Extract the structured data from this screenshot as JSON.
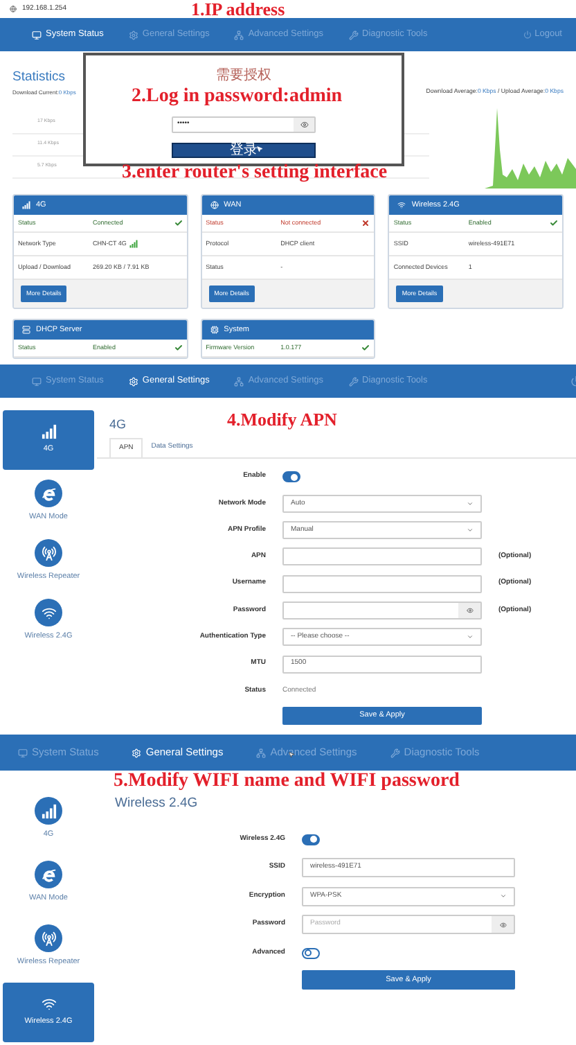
{
  "browser": {
    "address": "192.168.1.254"
  },
  "status_page": {
    "navbar": {
      "items": [
        {
          "label": "System Status",
          "selected": true
        },
        {
          "label": "General Settings",
          "selected": false
        },
        {
          "label": "Advanced Settings",
          "selected": false
        },
        {
          "label": "Diagnostic Tools",
          "selected": false
        }
      ],
      "logout": "Logout"
    },
    "statistics": {
      "title": "Statistics",
      "current": [
        {
          "label": "Download Current:",
          "value": "0 Kbps"
        }
      ],
      "averages": [
        {
          "label": "Download Average:",
          "value": "0 Kbps"
        },
        {
          "label": " / Upload Average:",
          "value": "0 Kbps"
        }
      ],
      "y_labels": [
        "17 Kbps",
        "11.4 Kbps",
        "5.7 Kbps"
      ]
    },
    "login_dialog": {
      "title": "需要授权",
      "password": "•••••",
      "button": "登录"
    },
    "cards": [
      {
        "title": "4G",
        "rows": [
          {
            "label": "Status",
            "value": "Connected",
            "kind": "check"
          },
          {
            "label": "Network Type",
            "value": "CHN-CT 4G",
            "kind": "signal"
          },
          {
            "label": "Upload / Download",
            "value": "269.20 KB / 7.91 KB",
            "kind": "plain"
          }
        ],
        "button": "More Details"
      },
      {
        "title": "WAN",
        "rows": [
          {
            "label": "Status",
            "value": "Not connected",
            "kind": "cross"
          },
          {
            "label": "Protocol",
            "value": "DHCP client",
            "kind": "plain"
          },
          {
            "label": "Status",
            "value": "-",
            "kind": "plain"
          }
        ],
        "button": "More Details"
      },
      {
        "title": "Wireless 2.4G",
        "rows": [
          {
            "label": "Status",
            "value": "Enabled",
            "kind": "check"
          },
          {
            "label": "SSID",
            "value": "wireless-491E71",
            "kind": "plain"
          },
          {
            "label": "Connected Devices",
            "value": "1",
            "kind": "plain"
          }
        ],
        "button": "More Details"
      },
      {
        "title": "DHCP Server",
        "rows": [
          {
            "label": "Status",
            "value": "Enabled",
            "kind": "check"
          }
        ]
      },
      {
        "title": "System",
        "rows": [
          {
            "label": "Firmware Version",
            "value": "1.0.177",
            "kind": "check"
          }
        ]
      }
    ]
  },
  "apn_page": {
    "navbar": {
      "items": [
        {
          "label": "System Status",
          "selected": false
        },
        {
          "label": "General Settings",
          "selected": true
        },
        {
          "label": "Advanced Settings",
          "selected": false
        },
        {
          "label": "Diagnostic Tools",
          "selected": false
        }
      ]
    },
    "sidebar": [
      {
        "label": "4G",
        "selected": true
      },
      {
        "label": "WAN Mode",
        "selected": false
      },
      {
        "label": "Wireless Repeater",
        "selected": false
      },
      {
        "label": "Wireless 2.4G",
        "selected": false
      }
    ],
    "title": "4G",
    "tabs": [
      {
        "label": "APN",
        "selected": true
      },
      {
        "label": "Data Settings",
        "selected": false
      }
    ],
    "form": [
      {
        "kind": "switch",
        "label": "Enable",
        "on": true
      },
      {
        "kind": "select",
        "label": "Network Mode",
        "value": "Auto"
      },
      {
        "kind": "select",
        "label": "APN Profile",
        "value": "Manual"
      },
      {
        "kind": "input",
        "label": "APN",
        "note": "(Optional)"
      },
      {
        "kind": "input",
        "label": "Username",
        "note": "(Optional)"
      },
      {
        "kind": "password",
        "label": "Password",
        "note": "(Optional)"
      },
      {
        "kind": "select",
        "label": "Authentication Type",
        "value": "-- Please choose --"
      },
      {
        "kind": "input",
        "label": "MTU",
        "value": "1500"
      },
      {
        "kind": "text",
        "label": "Status",
        "value": "Connected"
      }
    ],
    "button": "Save & Apply"
  },
  "wireless_page": {
    "navbar": {
      "items": [
        {
          "label": "System Status",
          "selected": false
        },
        {
          "label": "General Settings",
          "selected": true
        },
        {
          "label": "Advanced Settings",
          "selected": false
        },
        {
          "label": "Diagnostic Tools",
          "selected": false
        }
      ]
    },
    "sidebar": [
      {
        "label": "4G",
        "selected": false
      },
      {
        "label": "WAN Mode",
        "selected": false
      },
      {
        "label": "Wireless Repeater",
        "selected": false
      },
      {
        "label": "Wireless 2.4G",
        "selected": true
      }
    ],
    "title": "Wireless 2.4G",
    "form": [
      {
        "kind": "switch",
        "label": "Wireless 2.4G",
        "on": true
      },
      {
        "kind": "input",
        "label": "SSID",
        "value": "wireless-491E71"
      },
      {
        "kind": "select",
        "label": "Encryption",
        "value": "WPA-PSK"
      },
      {
        "kind": "password",
        "label": "Password",
        "placeholder": "Password"
      },
      {
        "kind": "switch",
        "label": "Advanced",
        "on": false
      }
    ],
    "button": "Save & Apply"
  },
  "annotations": [
    {
      "text": "1.IP address"
    },
    {
      "text": "2.Log in password:admin"
    },
    {
      "text": "3.enter router's setting interface"
    },
    {
      "text": "4.Modify APN"
    },
    {
      "text": "5.Modify WIFI name and WIFI password"
    }
  ]
}
